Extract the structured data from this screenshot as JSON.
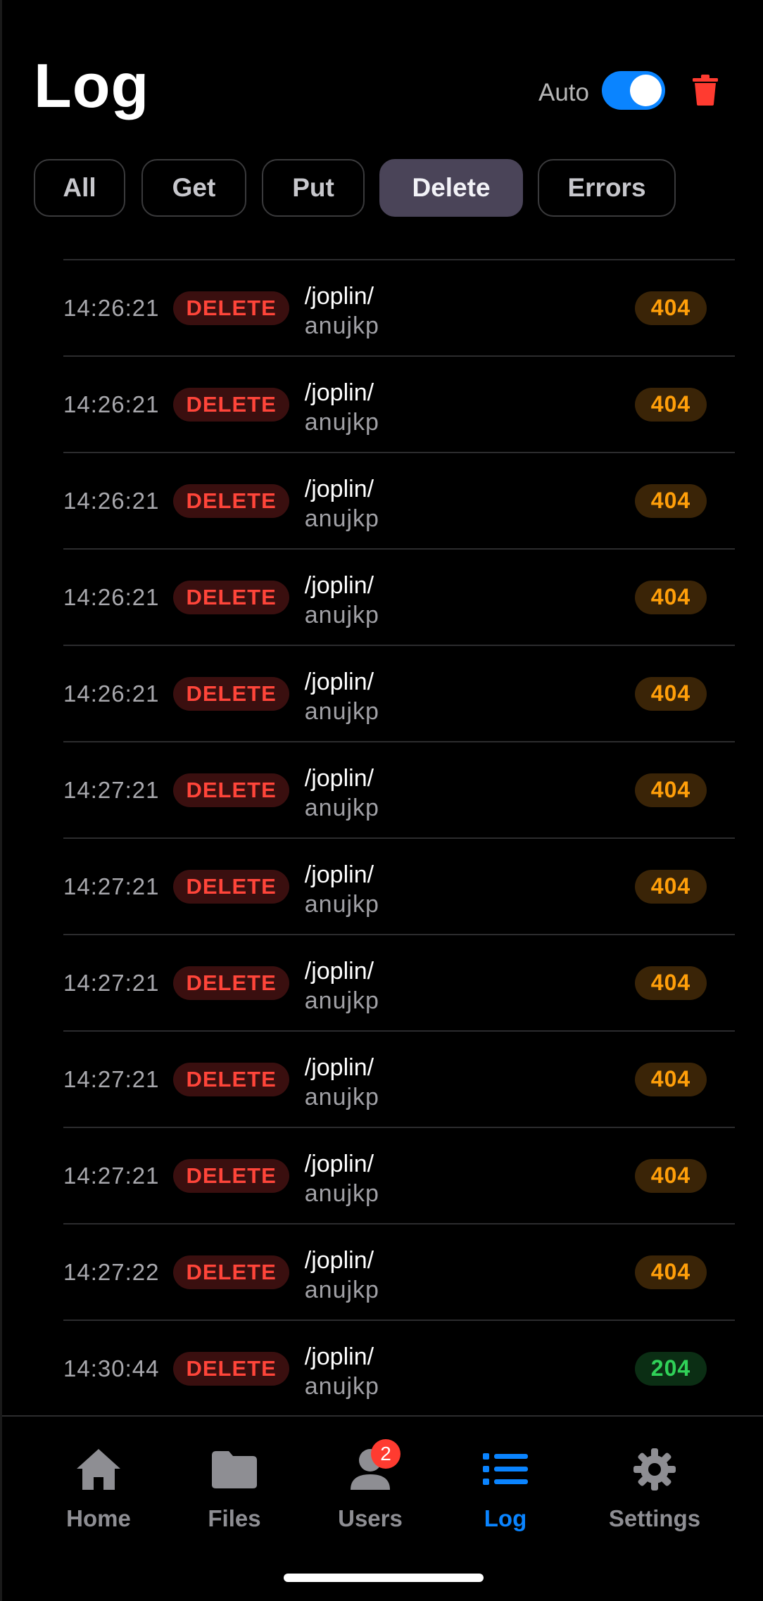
{
  "header": {
    "title": "Log",
    "auto_label": "Auto",
    "auto_enabled": true
  },
  "filters": [
    {
      "label": "All",
      "active": false
    },
    {
      "label": "Get",
      "active": false
    },
    {
      "label": "Put",
      "active": false
    },
    {
      "label": "Delete",
      "active": true
    },
    {
      "label": "Errors",
      "active": false
    }
  ],
  "entries": [
    {
      "time": "14:26:21",
      "method": "DELETE",
      "path": "/joplin/",
      "user": "anujkp",
      "status": "404"
    },
    {
      "time": "14:26:21",
      "method": "DELETE",
      "path": "/joplin/",
      "user": "anujkp",
      "status": "404"
    },
    {
      "time": "14:26:21",
      "method": "DELETE",
      "path": "/joplin/",
      "user": "anujkp",
      "status": "404"
    },
    {
      "time": "14:26:21",
      "method": "DELETE",
      "path": "/joplin/",
      "user": "anujkp",
      "status": "404"
    },
    {
      "time": "14:26:21",
      "method": "DELETE",
      "path": "/joplin/",
      "user": "anujkp",
      "status": "404"
    },
    {
      "time": "14:27:21",
      "method": "DELETE",
      "path": "/joplin/",
      "user": "anujkp",
      "status": "404"
    },
    {
      "time": "14:27:21",
      "method": "DELETE",
      "path": "/joplin/",
      "user": "anujkp",
      "status": "404"
    },
    {
      "time": "14:27:21",
      "method": "DELETE",
      "path": "/joplin/",
      "user": "anujkp",
      "status": "404"
    },
    {
      "time": "14:27:21",
      "method": "DELETE",
      "path": "/joplin/",
      "user": "anujkp",
      "status": "404"
    },
    {
      "time": "14:27:21",
      "method": "DELETE",
      "path": "/joplin/",
      "user": "anujkp",
      "status": "404"
    },
    {
      "time": "14:27:22",
      "method": "DELETE",
      "path": "/joplin/",
      "user": "anujkp",
      "status": "404"
    },
    {
      "time": "14:30:44",
      "method": "DELETE",
      "path": "/joplin/",
      "user": "anujkp",
      "status": "204"
    }
  ],
  "tabbar": [
    {
      "label": "Home",
      "icon": "home-icon",
      "active": false
    },
    {
      "label": "Files",
      "icon": "folder-icon",
      "active": false
    },
    {
      "label": "Users",
      "icon": "user-icon",
      "active": false,
      "badge": "2"
    },
    {
      "label": "Log",
      "icon": "list-icon",
      "active": true
    },
    {
      "label": "Settings",
      "icon": "gear-icon",
      "active": false
    }
  ],
  "colors": {
    "accent": "#0a84ff",
    "danger": "#ff453a",
    "warning": "#ff9f0a",
    "success": "#30d158"
  }
}
